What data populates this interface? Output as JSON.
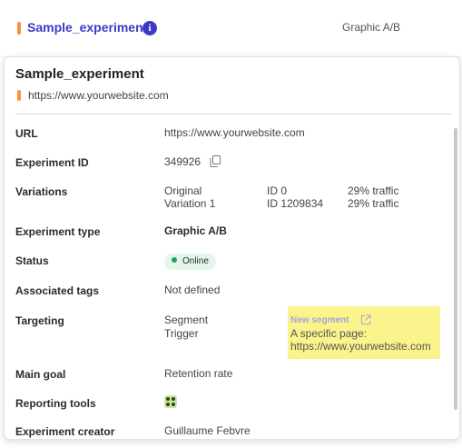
{
  "header": {
    "experiment_name": "Sample_experiment",
    "info_icon": "info-icon",
    "type": "Graphic A/B"
  },
  "panel": {
    "title": "Sample_experiment",
    "url": "https://www.yourwebsite.com",
    "rows": {
      "url": {
        "label": "URL",
        "value": "https://www.yourwebsite.com"
      },
      "experiment_id": {
        "label": "Experiment ID",
        "value": "349926",
        "icon": "copy-icon"
      },
      "variations": {
        "label": "Variations",
        "items": [
          {
            "name": "Original",
            "id": "ID 0",
            "traffic": "29% traffic"
          },
          {
            "name": "Variation 1",
            "id": "ID 1209834",
            "traffic": "29% traffic"
          }
        ]
      },
      "experiment_type": {
        "label": "Experiment type",
        "value": "Graphic A/B"
      },
      "status": {
        "label": "Status",
        "value": "Online",
        "color": "#1f9e5a"
      },
      "associated_tags": {
        "label": "Associated tags",
        "value": "Not defined"
      },
      "targeting": {
        "label": "Targeting",
        "segment_label": "Segment",
        "trigger_label": "Trigger",
        "segment_link": "New segment",
        "segment_link_icon": "external-link-icon",
        "segment_desc_line1": "A specific page:",
        "segment_desc_line2": "https://www.yourwebsite.com"
      },
      "main_goal": {
        "label": "Main goal",
        "value": "Retention rate"
      },
      "reporting_tools": {
        "label": "Reporting tools",
        "icon": "reporting-tool-icon"
      },
      "experiment_creator": {
        "label": "Experiment creator",
        "value": "Guillaume Febvre"
      }
    }
  },
  "colors": {
    "accent": "#3b3bc8",
    "orange": "#f5923e",
    "highlight": "#fbf38c",
    "status_bg": "#e4f6ec"
  }
}
